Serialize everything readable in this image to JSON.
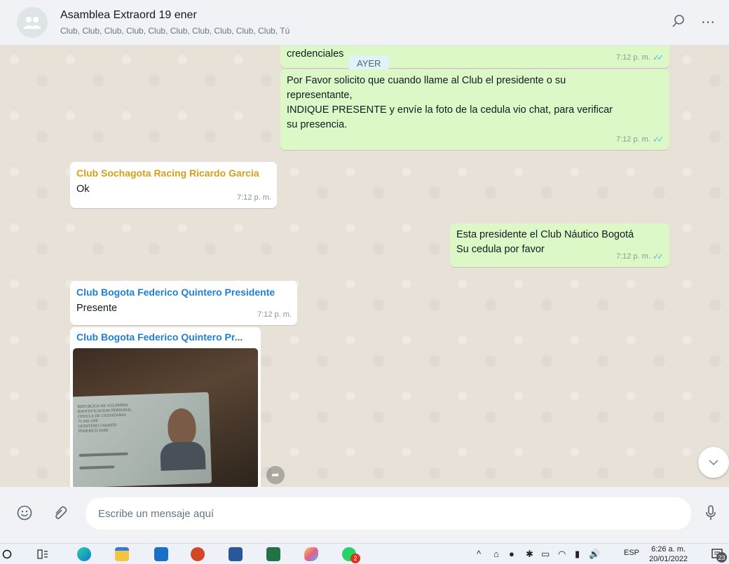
{
  "header": {
    "title": "Asamblea Extraord 19 ener",
    "participants": "Club, Club, Club, Club, Club, Club, Club, Club, Club, Club, Tú"
  },
  "day_pill": "AYER",
  "messages": [
    {
      "text": "credenciales",
      "time": "7:12 p. m."
    },
    {
      "lines": [
        "Por Favor solicito que cuando llame al Club el presidente o su",
        "representante,",
        "INDIQUE PRESENTE y envíe la foto de la cedula vio chat, para verificar",
        "su presencia."
      ],
      "time": "7:12 p. m."
    },
    {
      "sender": "Club Sochagota Racing Ricardo Garcia",
      "text": "Ok",
      "time": "7:12 p. m.",
      "sender_color": "#d4a017"
    },
    {
      "lines": [
        "Esta presidente el Club Náutico Bogotá",
        "Su cedula por favor"
      ],
      "time": "7:12 p. m."
    },
    {
      "sender": "Club Bogota Federico Quintero Presidente",
      "text": "Presente",
      "time": "7:12 p. m.",
      "sender_color": "#1f7fd4"
    },
    {
      "sender": "Club Bogota Federico Quintero Pr...",
      "sender_color": "#1f7fd4"
    }
  ],
  "photo_card_text": [
    "REPUBLICA DE COLOMBIA",
    "IDENTIFICACION PERSONAL",
    "CEDULA DE CIUDADANIA",
    "71.681.098",
    "QUINTERO CADAVID",
    "FEDERICO JOSE"
  ],
  "compose": {
    "placeholder": "Escribe un mensaje aquí"
  },
  "taskbar": {
    "time": "6:26 a. m.",
    "date": "20/01/2022",
    "lang": "ESP",
    "notif_count": "23",
    "app_badge": "2"
  },
  "colors": {
    "outgoing": "#dcf8c6",
    "incoming": "#ffffff",
    "ticks": "#53bdeb"
  }
}
